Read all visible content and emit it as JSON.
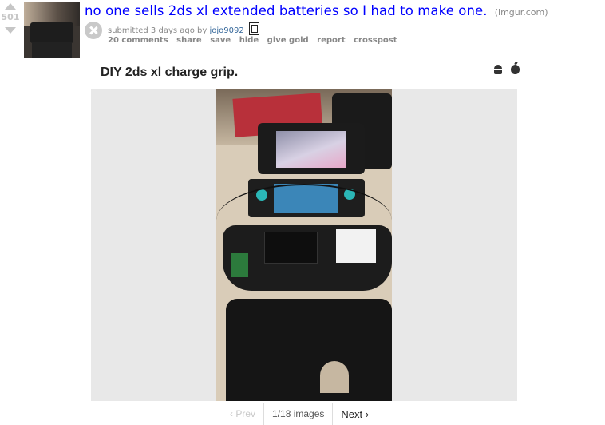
{
  "post": {
    "score": "501",
    "title": "no one sells 2ds xl extended batteries so I had to make one.",
    "domain": "(imgur.com)",
    "submitted_prefix": "submitted 3 days ago by",
    "author": "jojo9092",
    "buttons": [
      "20 comments",
      "share",
      "save",
      "hide",
      "give gold",
      "report",
      "crosspost"
    ]
  },
  "gallery": {
    "title": "DIY 2ds xl charge grip.",
    "pager": {
      "prev": "‹ Prev",
      "count": "1/18 images",
      "next": "Next ›"
    }
  },
  "icons": [
    "upvote-arrow-icon",
    "downvote-arrow-icon",
    "close-expando-icon",
    "user-flair-icon",
    "android-icon",
    "apple-icon"
  ],
  "colors": {
    "title_link": "#0000ff",
    "author": "#336699",
    "muted": "#888888"
  }
}
